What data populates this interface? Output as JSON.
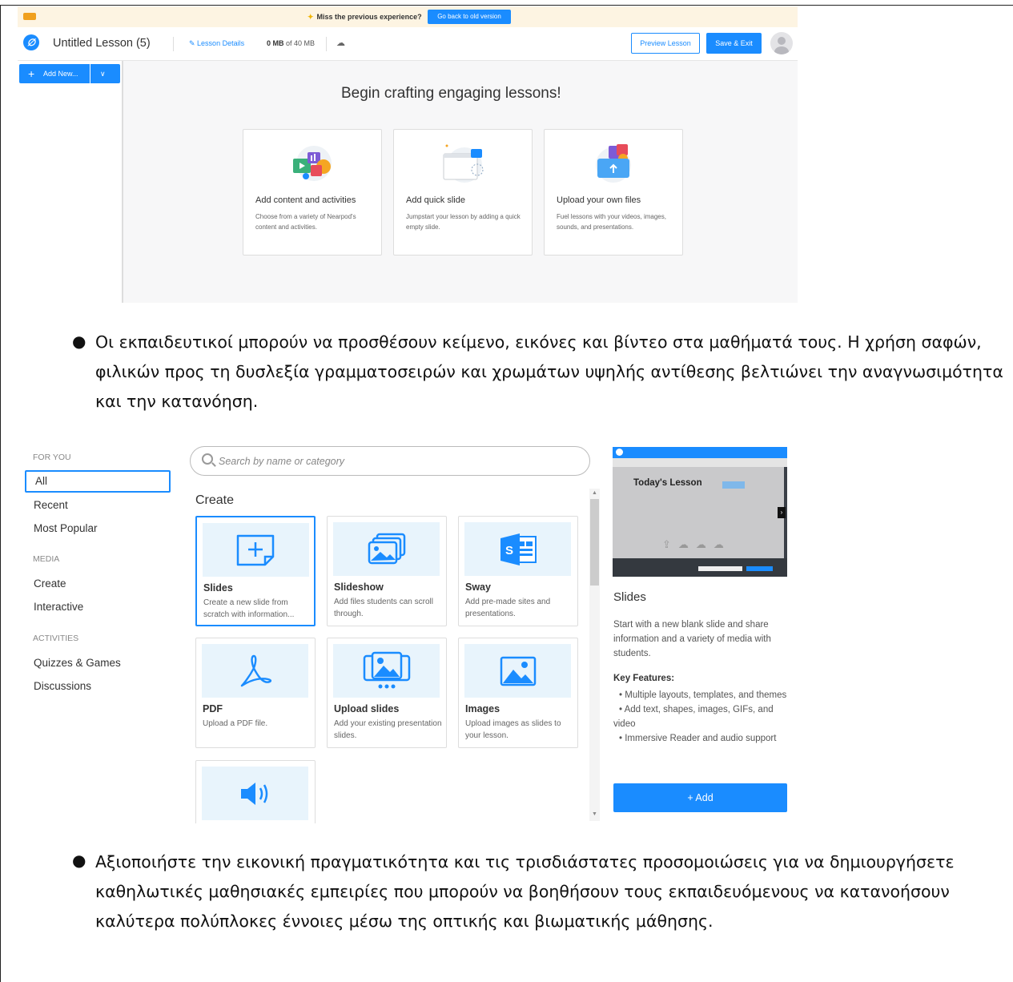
{
  "editor": {
    "banner_message": "Miss the previous experience?",
    "banner_button": "Go back to old version",
    "lesson_title": "Untitled Lesson (5)",
    "lesson_details": "Lesson Details",
    "storage_used": "0 MB",
    "storage_total": "of 40 MB",
    "preview_button": "Preview Lesson",
    "save_button": "Save & Exit",
    "add_new_button": "Add New...",
    "heading": "Begin crafting engaging lessons!",
    "cards": [
      {
        "title": "Add content and activities",
        "desc": "Choose from a variety of Nearpod's content and activities."
      },
      {
        "title": "Add quick slide",
        "desc": "Jumpstart your lesson by adding a quick empty slide."
      },
      {
        "title": "Upload your own files",
        "desc": "Fuel lessons with your videos, images, sounds, and presentations."
      }
    ]
  },
  "bullets": [
    "Οι εκπαιδευτικοί μπορούν να προσθέσουν κείμενο, εικόνες και βίντεο στα μαθήματά τους. Η χρήση σαφών, φιλικών προς τη δυσλεξία γραμματοσειρών και χρωμάτων υψηλής αντίθεσης βελτιώνει την αναγνωσιμότητα και την κατανόηση.",
    "Αξιοποιήστε την εικονική πραγματικότητα και τις τρισδιάστατες προσομοιώσεις για να δημιουργήσετε καθηλωτικές μαθησιακές εμπειρίες που μπορούν να βοηθήσουν τους εκπαιδευόμενους να κατανοήσουν καλύτερα πολύπλοκες έννοιες μέσω της οπτικής και βιωματικής μάθησης."
  ],
  "picker": {
    "categories": {
      "for_you_heading": "FOR YOU",
      "all": "All",
      "recent": "Recent",
      "most_popular": "Most Popular",
      "media_heading": "MEDIA",
      "create": "Create",
      "interactive": "Interactive",
      "activities_heading": "ACTIVITIES",
      "quizzes": "Quizzes & Games",
      "discussions": "Discussions"
    },
    "search_placeholder": "Search by name or category",
    "section_heading": "Create",
    "tiles": [
      {
        "title": "Slides",
        "desc": "Create a new slide from scratch with information..."
      },
      {
        "title": "Slideshow",
        "desc": "Add files students can scroll through."
      },
      {
        "title": "Sway",
        "desc": "Add pre-made sites and presentations."
      },
      {
        "title": "PDF",
        "desc": "Upload a PDF file."
      },
      {
        "title": "Upload slides",
        "desc": "Add your existing presentation slides."
      },
      {
        "title": "Images",
        "desc": "Upload images as slides to your lesson."
      }
    ],
    "preview_slide_title": "Today's Lesson",
    "detail": {
      "title": "Slides",
      "desc": "Start with a new blank slide and share information and a variety of media with students.",
      "key_features_heading": "Key Features:",
      "features": [
        "Multiple layouts, templates, and themes",
        "Add text, shapes, images, GIFs, and video",
        "Immersive Reader and audio support"
      ],
      "add_button": "+ Add"
    }
  },
  "colors": {
    "accent": "#1a8cff",
    "tile_bg": "#e8f4fc",
    "banner_bg": "#fdf4e2"
  }
}
